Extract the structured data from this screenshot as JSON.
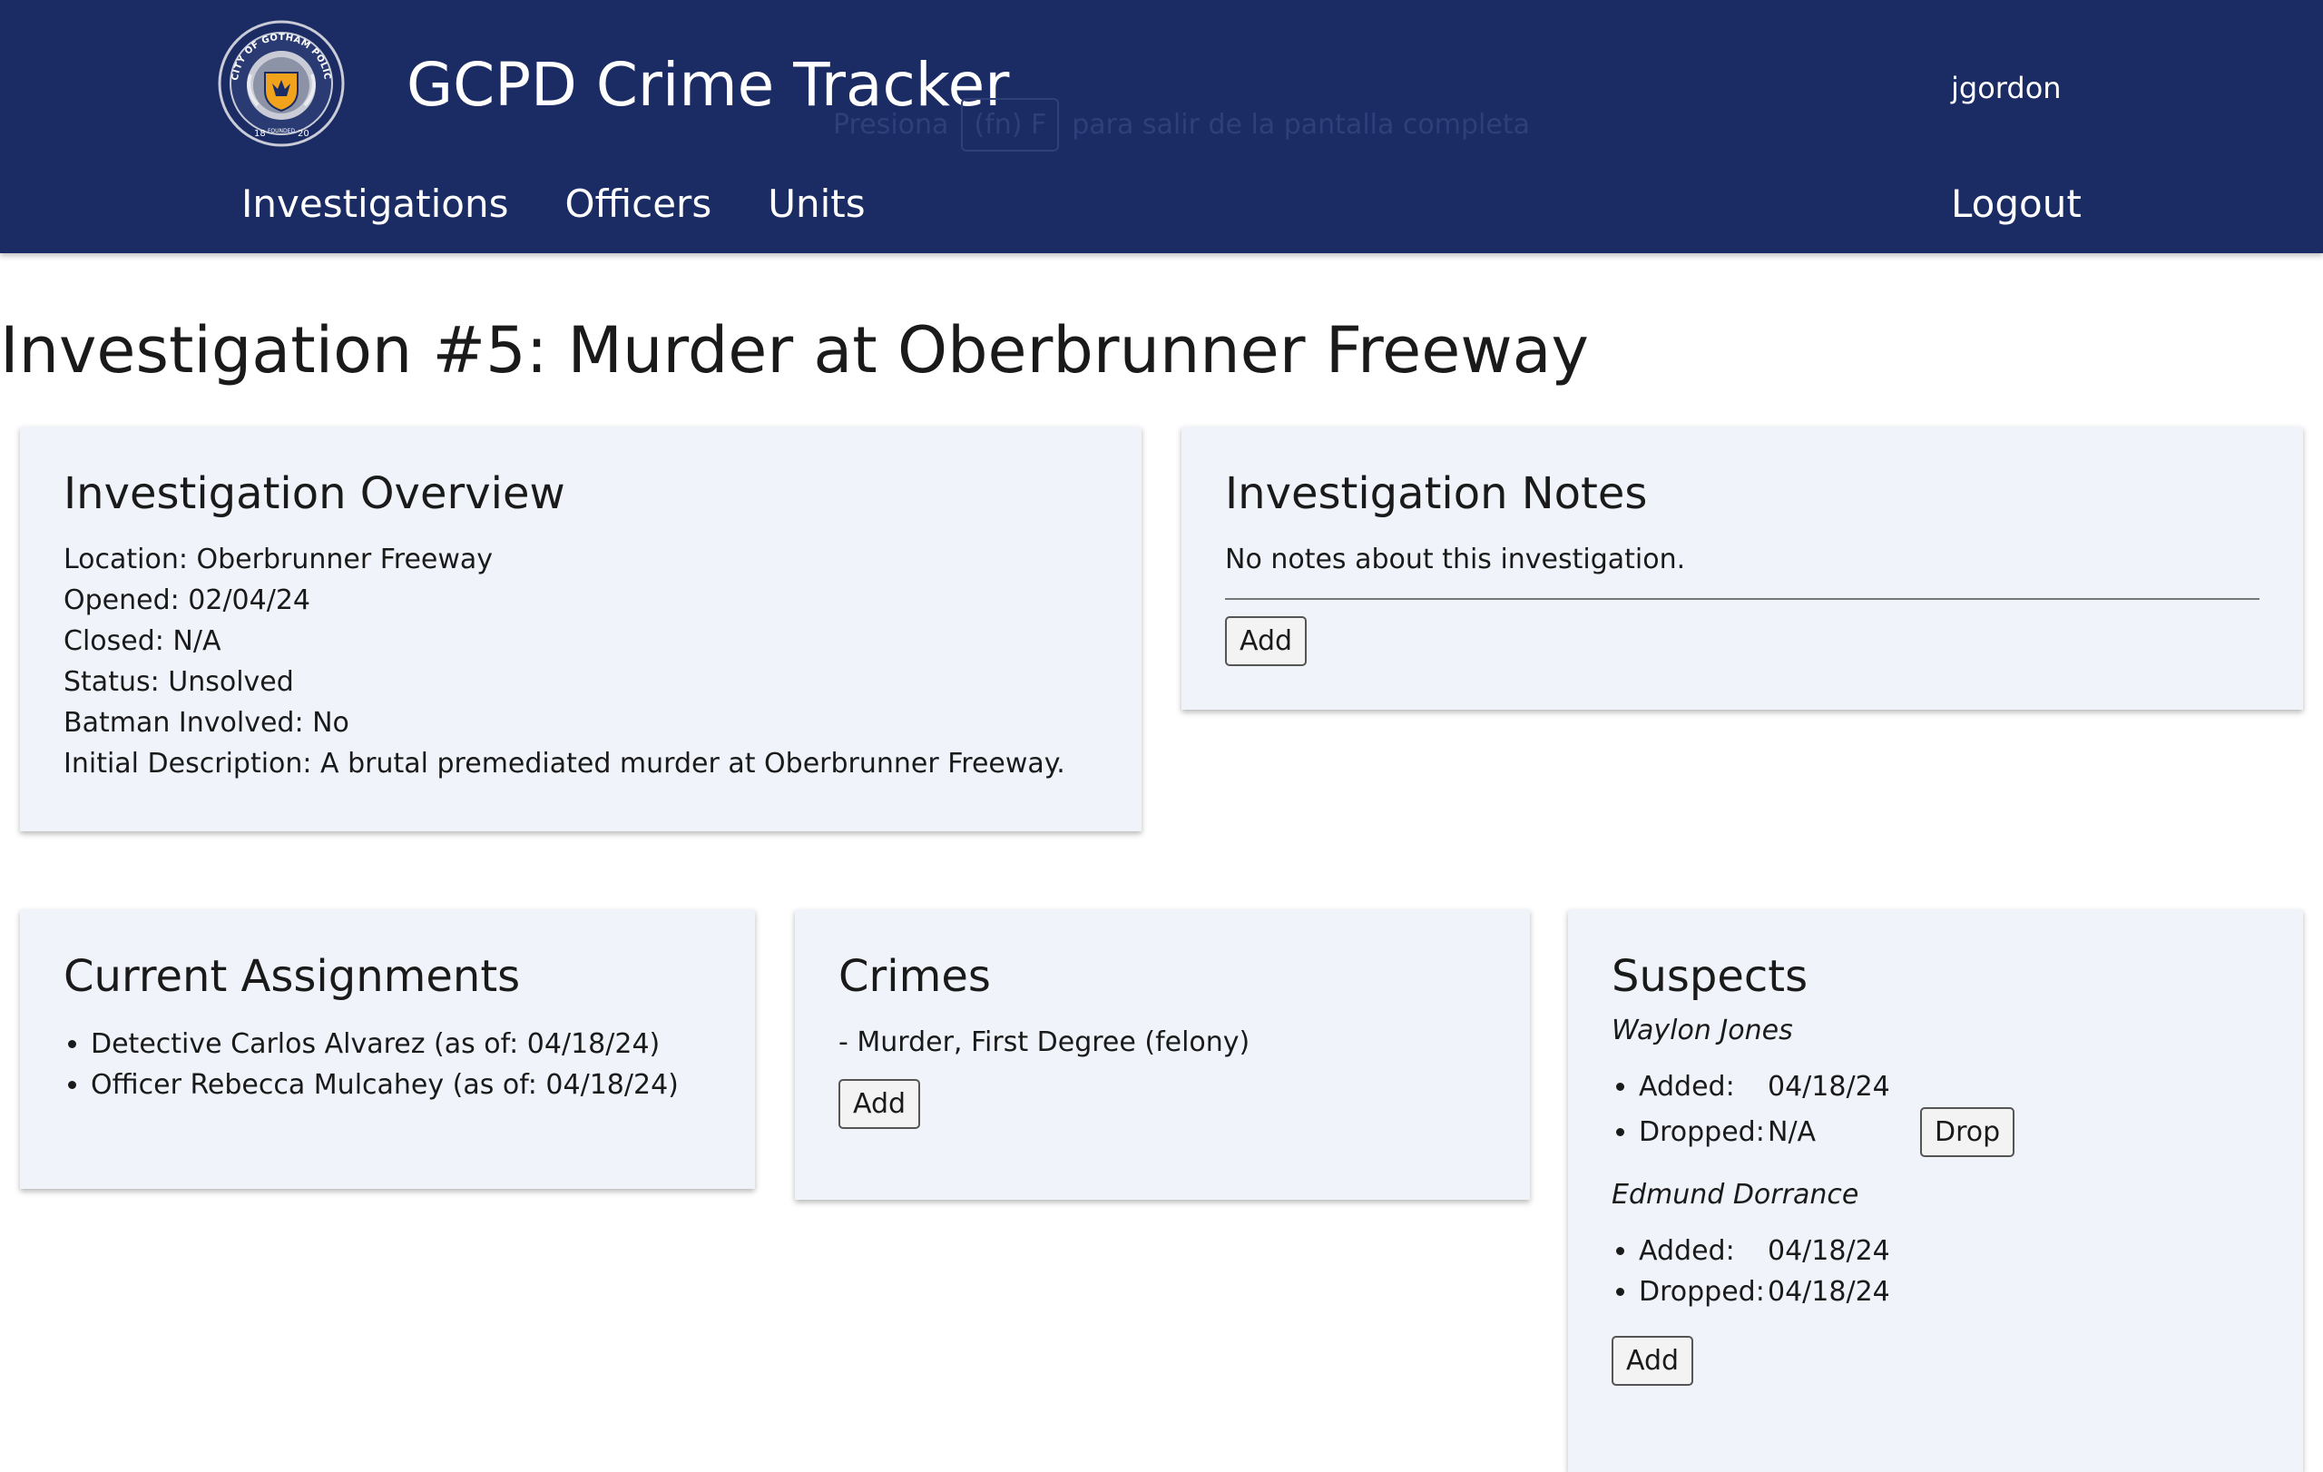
{
  "header": {
    "app_title": "GCPD Crime Tracker",
    "username": "jgordon",
    "logo_alt": "City of Gotham Police Department seal",
    "logo_text_top": "CITY OF GOTHAM POLICE DEPARTMENT",
    "logo_year_left": "18",
    "logo_year_right": "20",
    "logo_founded": "FOUNDED",
    "fullscreen_hint": {
      "prefix": "Presiona",
      "key": "(fn) F",
      "suffix": "para salir de la pantalla completa"
    },
    "nav": {
      "investigations": "Investigations",
      "officers": "Officers",
      "units": "Units"
    },
    "logout": "Logout"
  },
  "page": {
    "title": "Investigation #5: Murder at Oberbrunner Freeway"
  },
  "overview": {
    "heading": "Investigation Overview",
    "location": "Location: Oberbrunner Freeway",
    "opened": "Opened: 02/04/24",
    "closed": "Closed: N/A",
    "status": "Status: Unsolved",
    "batman": "Batman Involved: No",
    "description": "Initial Description: A brutal premediated murder at Oberbrunner Freeway."
  },
  "notes": {
    "heading": "Investigation Notes",
    "empty_text": "No notes about this investigation.",
    "add_label": "Add"
  },
  "assignments": {
    "heading": "Current Assignments",
    "items": [
      "Detective Carlos Alvarez (as of: 04/18/24)",
      "Officer Rebecca Mulcahey (as of: 04/18/24)"
    ]
  },
  "crimes": {
    "heading": "Crimes",
    "items": [
      "- Murder, First Degree (felony)"
    ],
    "add_label": "Add"
  },
  "suspects": {
    "heading": "Suspects",
    "added_label": "Added:",
    "dropped_label": "Dropped:",
    "drop_label": "Drop",
    "add_label": "Add",
    "list": [
      {
        "name": "Waylon Jones",
        "added": "04/18/24",
        "dropped": "N/A"
      },
      {
        "name": "Edmund Dorrance",
        "added": "04/18/24",
        "dropped": "04/18/24"
      }
    ]
  },
  "colors": {
    "header_bg": "#1b2b63",
    "card_bg": "#f0f3fa",
    "badge_gold": "#f2a31c"
  }
}
